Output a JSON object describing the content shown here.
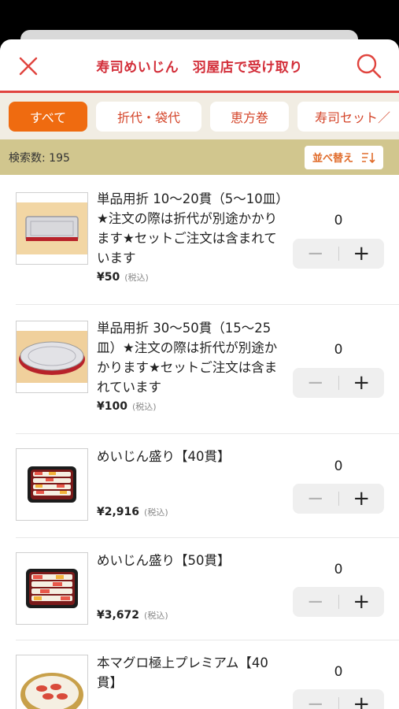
{
  "header": {
    "title": "寿司めいじん　羽屋店で受け取り",
    "accent_color": "#d32f3a"
  },
  "categories": [
    "すべて",
    "折代・袋代",
    "恵方巻",
    "寿司セット／"
  ],
  "count_label": "検索数: 195",
  "sort_label": "並べ替え",
  "products": [
    {
      "name": "単品用折 10〜20貫（5〜10皿）★注文の際は折代が別途かかります★セットご注文は含まれています",
      "price": "¥50",
      "tax": "(税込)",
      "quantity": "0",
      "thumb": "small-tray"
    },
    {
      "name": "単品用折 30〜50貫（15〜25皿）★注文の際は折代が別途かかります★セットご注文は含まれています",
      "price": "¥100",
      "tax": "(税込)",
      "quantity": "0",
      "thumb": "round-tray"
    },
    {
      "name": "めいじん盛り【40貫】",
      "price": "¥2,916",
      "tax": "(税込)",
      "quantity": "0",
      "thumb": "sushi-platter"
    },
    {
      "name": "めいじん盛り【50貫】",
      "price": "¥3,672",
      "tax": "(税込)",
      "quantity": "0",
      "thumb": "sushi-platter"
    },
    {
      "name": "本マグロ極上プレミアム【40貫】",
      "price": "",
      "tax": "",
      "quantity": "0",
      "thumb": "tuna-platter"
    }
  ]
}
